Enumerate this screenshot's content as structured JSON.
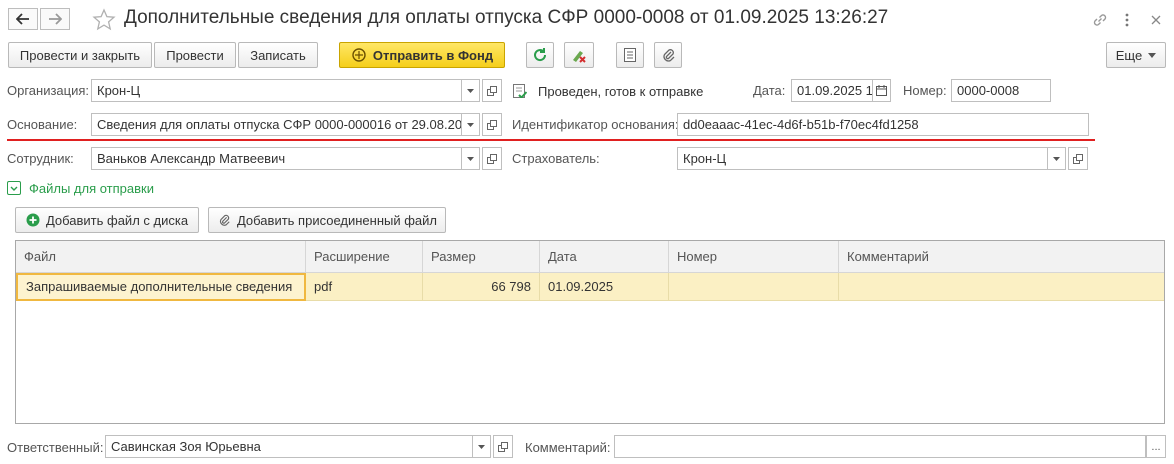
{
  "window": {
    "title": "Дополнительные сведения для оплаты отпуска СФР 0000-0008 от 01.09.2025 13:26:27"
  },
  "toolbar": {
    "post_close": "Провести и закрыть",
    "post": "Провести",
    "save": "Записать",
    "send_fund": "Отправить в Фонд",
    "more": "Еще"
  },
  "form": {
    "org_label": "Организация:",
    "org_value": "Крон-Ц",
    "status_text": "Проведен, готов к отправке",
    "date_label": "Дата:",
    "date_value": "01.09.2025 1",
    "number_label": "Номер:",
    "number_value": "0000-0008",
    "basis_label": "Основание:",
    "basis_value": "Сведения для оплаты отпуска СФР 0000-000016 от 29.08.20",
    "basis_id_label": "Идентификатор основания:",
    "basis_id_value": "dd0eaaac-41ec-4d6f-b51b-f70ec4fd1258",
    "employee_label": "Сотрудник:",
    "employee_value": "Ваньков Александр Матвеевич",
    "insurer_label": "Страхователь:",
    "insurer_value": "Крон-Ц",
    "responsible_label": "Ответственный:",
    "responsible_value": "Савинская Зоя Юрьевна",
    "comment_label": "Комментарий:",
    "comment_value": "",
    "more_dots": "..."
  },
  "files": {
    "section_title": "Файлы для отправки",
    "add_disk": "Добавить файл с диска",
    "add_attached": "Добавить присоединенный файл",
    "columns": [
      "Файл",
      "Расширение",
      "Размер",
      "Дата",
      "Номер",
      "Комментарий"
    ],
    "rows": [
      [
        "Запрашиваемые дополнительные сведения",
        "pdf",
        "66 798",
        "01.09.2025",
        "",
        ""
      ]
    ]
  },
  "colors": {
    "accent_yellow": "#f5cf1a",
    "selected_row": "#fbf0c4",
    "underline_red": "#e02020",
    "section_green": "#2a9d4b"
  }
}
